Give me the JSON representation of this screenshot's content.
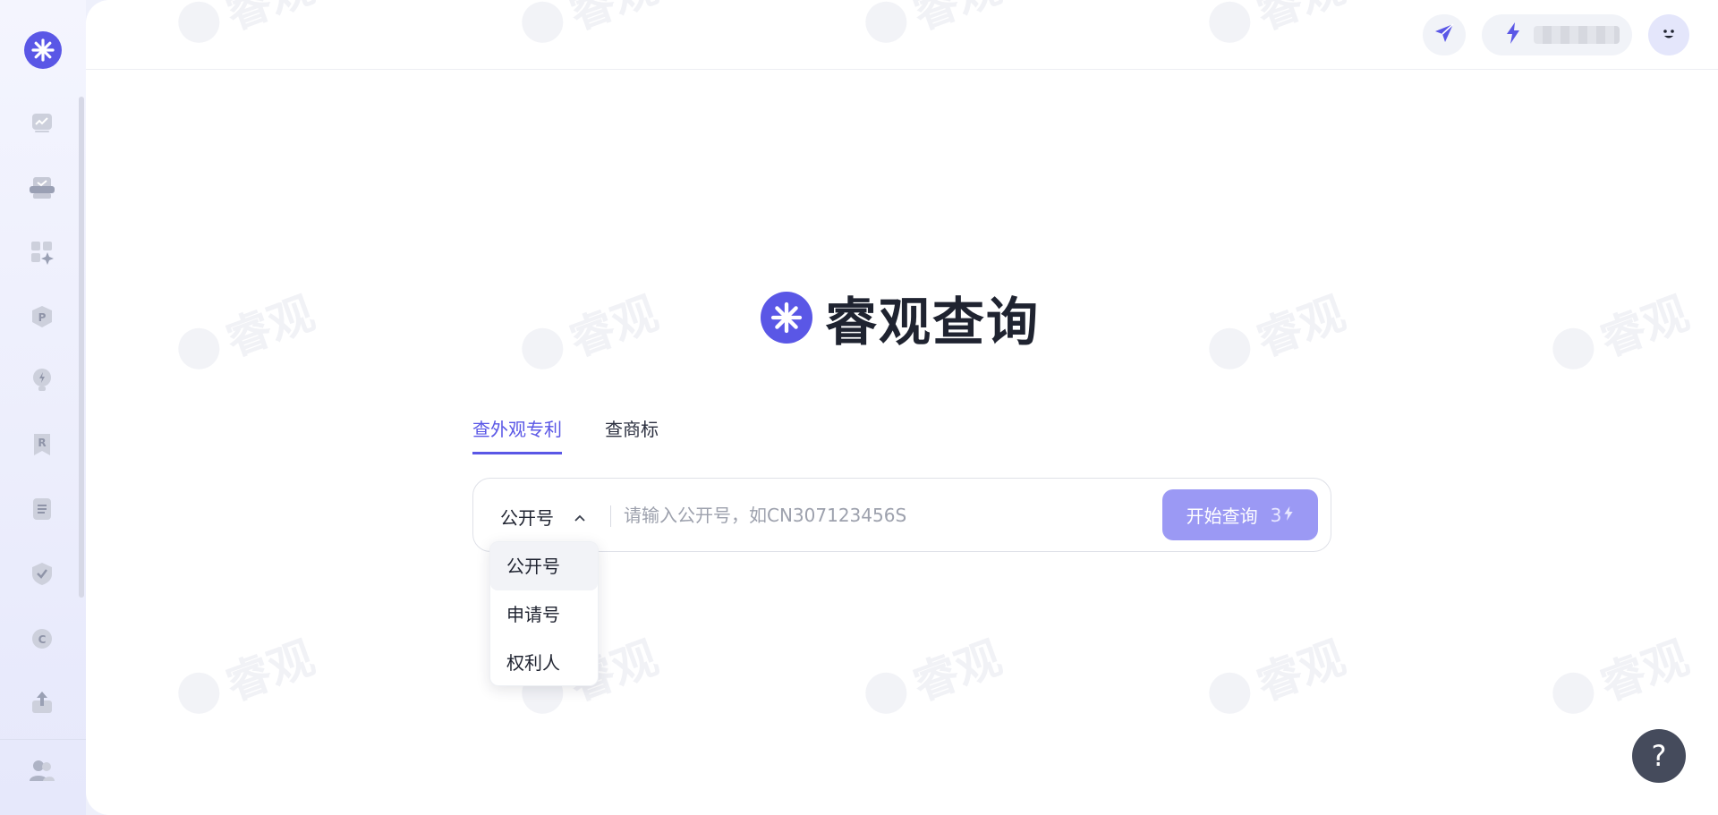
{
  "app": {
    "brand_color": "#5a57e6",
    "watermark_text": "睿观"
  },
  "sidebar": {
    "items": [
      {
        "icon": "chart-line-icon"
      },
      {
        "icon": "scanner-icon"
      },
      {
        "icon": "apps-sparkle-icon"
      },
      {
        "icon": "patent-p-icon"
      },
      {
        "icon": "bulb-bolt-icon"
      },
      {
        "icon": "report-r-icon"
      },
      {
        "icon": "document-list-icon"
      },
      {
        "icon": "shield-check-icon"
      },
      {
        "icon": "copyright-c-icon"
      },
      {
        "icon": "upload-icon"
      }
    ],
    "bottom_icon": "users-icon"
  },
  "topbar": {
    "send_icon": "paper-plane-icon",
    "credits_icon": "bolt-icon",
    "avatar_icon": "smiley-avatar-icon"
  },
  "hero": {
    "title": "睿观查询"
  },
  "tabs": [
    {
      "label": "查外观专利",
      "active": true
    },
    {
      "label": "查商标",
      "active": false
    }
  ],
  "search": {
    "type_selected": "公开号",
    "placeholder": "请输入公开号，如CN307123456S",
    "value": "",
    "submit_label": "开始查询",
    "cost": "3"
  },
  "dropdown": {
    "options": [
      "公开号",
      "申请号",
      "权利人"
    ],
    "selected_index": 0
  },
  "help": {
    "label": "?"
  }
}
